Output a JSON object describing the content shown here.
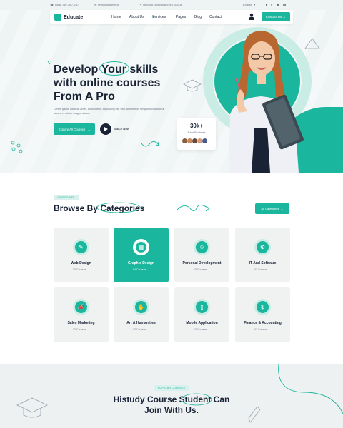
{
  "topbar": {
    "phone": "(368) 367-897-237",
    "email": "[email protected]",
    "address": "Hudson, Wisconsin(WI), 54016",
    "language": "English",
    "social": [
      "f",
      "t",
      "in",
      "ig"
    ]
  },
  "header": {
    "logo_text": "Educate",
    "nav": [
      "Home",
      "About Us",
      "Services",
      "Pages",
      "Blog",
      "Contact"
    ],
    "active_nav": "Services",
    "cta_label": "Contact Us"
  },
  "hero": {
    "title_line1_a": "Develop ",
    "title_highlight": "Your",
    "title_line1_b": " skills",
    "title_line2": "with online courses",
    "title_line3": "From A Pro",
    "subtitle": "Lorem ipsum dolor sit amet, consectetur adipiscing elit, sed do eiusmod tempor incididunt ut labore et dolore magna aliqua.",
    "primary_btn": "Explore All Courses",
    "watch_label": "Watch Now",
    "stat_value": "30k+",
    "stat_label": "Total Students"
  },
  "categories_section": {
    "badge": "Categories",
    "title_a": "Browse By ",
    "title_b": "Categories",
    "all_btn": "All Categories",
    "items": [
      {
        "name": "Web Design",
        "count": "03 Courses",
        "icon": "web-design-icon",
        "active": false
      },
      {
        "name": "Graphic Design",
        "count": "04 Courses",
        "icon": "graphic-design-icon",
        "active": true
      },
      {
        "name": "Personal Development",
        "count": "03 Courses",
        "icon": "personal-dev-icon",
        "active": false
      },
      {
        "name": "IT And Software",
        "count": "03 Courses",
        "icon": "it-software-icon",
        "active": false
      },
      {
        "name": "Sales Marketing",
        "count": "02 Courses",
        "icon": "sales-marketing-icon",
        "active": false
      },
      {
        "name": "Art & Humanities",
        "count": "02 Courses",
        "icon": "art-humanities-icon",
        "active": false
      },
      {
        "name": "Mobile Application",
        "count": "02 Courses",
        "icon": "mobile-app-icon",
        "active": false
      },
      {
        "name": "Finance & Accounting",
        "count": "02 Courses",
        "icon": "finance-icon",
        "active": false
      }
    ]
  },
  "story_section": {
    "badge": "Popular Courses",
    "title_line1_a": "Histudy Course ",
    "title_line1_b": "Student",
    "title_line1_c": " Can",
    "title_line2": "Join With Us."
  },
  "colors": {
    "accent": "#1ab69d",
    "dark": "#192335",
    "muted": "#6b7385",
    "hero_bg": "#eef4f3",
    "card_bg": "#f0f2f2"
  }
}
